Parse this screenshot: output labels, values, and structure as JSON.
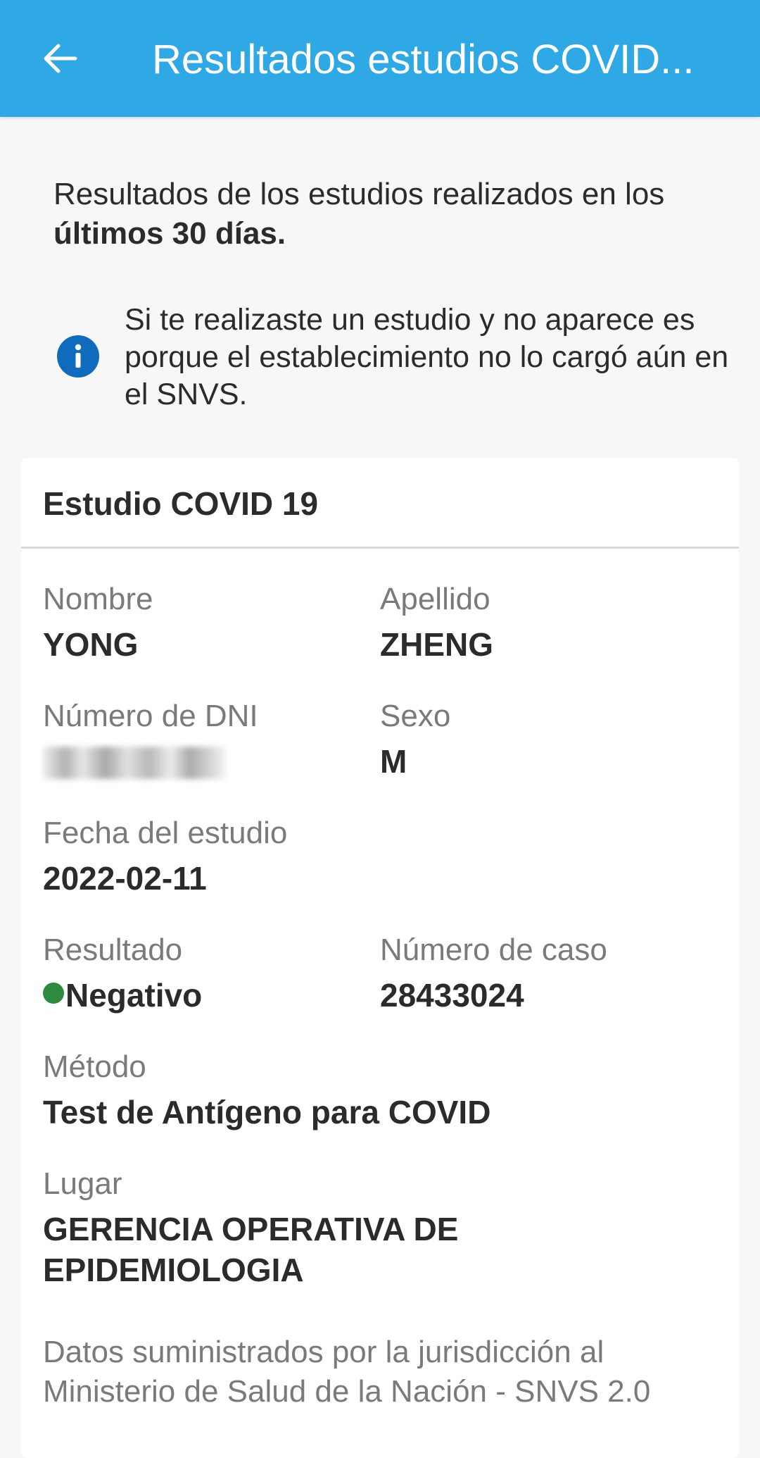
{
  "appbar": {
    "title": "Resultados estudios COVID...",
    "back_icon": "arrow-left-icon"
  },
  "intro": {
    "text_prefix": "Resultados de los estudios realizados en los ",
    "text_bold": "últimos 30 días."
  },
  "notice": {
    "icon": "info-icon",
    "text": "Si te realizaste un estudio y no aparece es porque el establecimiento no lo cargó aún en el SNVS."
  },
  "card": {
    "title": "Estudio COVID 19",
    "fields": {
      "nombre": {
        "label": "Nombre",
        "value": "YONG"
      },
      "apellido": {
        "label": "Apellido",
        "value": "ZHENG"
      },
      "dni": {
        "label": "Número de DNI",
        "value": ""
      },
      "sexo": {
        "label": "Sexo",
        "value": "M"
      },
      "fecha": {
        "label": "Fecha del estudio",
        "value": "2022-02-11"
      },
      "resultado": {
        "label": "Resultado",
        "value": "Negativo"
      },
      "caso": {
        "label": "Número de caso",
        "value": "28433024"
      },
      "metodo": {
        "label": "Método",
        "value": "Test de Antígeno para COVID"
      },
      "lugar": {
        "label": "Lugar",
        "value": "GERENCIA OPERATIVA DE EPIDEMIOLOGIA"
      }
    },
    "footer": "Datos suministrados por la jurisdicción al Ministerio de Salud de la Nación - SNVS 2.0"
  },
  "colors": {
    "appbar": "#2fa8e6",
    "info_icon": "#0f6cbd",
    "status_negative": "#2e8b3e"
  }
}
